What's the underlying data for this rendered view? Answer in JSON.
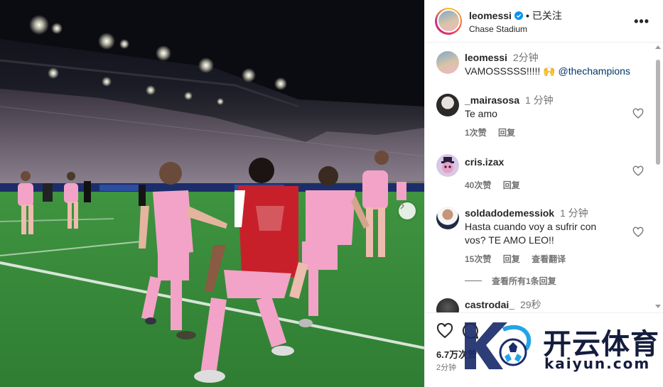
{
  "post": {
    "username": "leomessi",
    "follow_state": "已关注",
    "location": "Chase Stadium",
    "more_label": "•••",
    "likes": "6.7万次赞",
    "time": "2分钟"
  },
  "comments": [
    {
      "user": "leomessi",
      "time": "2分钟",
      "text": "VAMOSSSSS!!!!! 🙌",
      "mention": "@thechampions",
      "likes": "",
      "reply": "",
      "translate": ""
    },
    {
      "user": "_mairasosa",
      "time": "1 分钟",
      "text": "Te amo",
      "likes": "1次赞",
      "reply": "回复",
      "translate": ""
    },
    {
      "user": "cris.izax",
      "time": "",
      "text": "",
      "likes": "40次赞",
      "reply": "回复",
      "translate": ""
    },
    {
      "user": "soldadodemessiok",
      "time": "1 分钟",
      "text": "Hasta cuando voy a sufrir con vos? TE AMO LEO!!",
      "likes": "15次赞",
      "reply": "回复",
      "translate": "查看翻译"
    },
    {
      "user": "castrodai_",
      "time": "29秒",
      "text": "",
      "likes": "",
      "reply": "",
      "translate": ""
    }
  ],
  "view_replies": "查看所有1条回复",
  "watermark": {
    "cn": "开云体育",
    "en": "kaiyun.com"
  },
  "icons": {
    "verified": "verified-badge-icon",
    "more": "more-options-icon",
    "heart": "heart-icon",
    "comment": "comment-icon",
    "next": "chevron-right-icon"
  },
  "colors": {
    "verified_blue": "#0095f6",
    "mention": "#00376b",
    "secondary_text": "#737373",
    "pink_kit": "#f2a3c7"
  }
}
